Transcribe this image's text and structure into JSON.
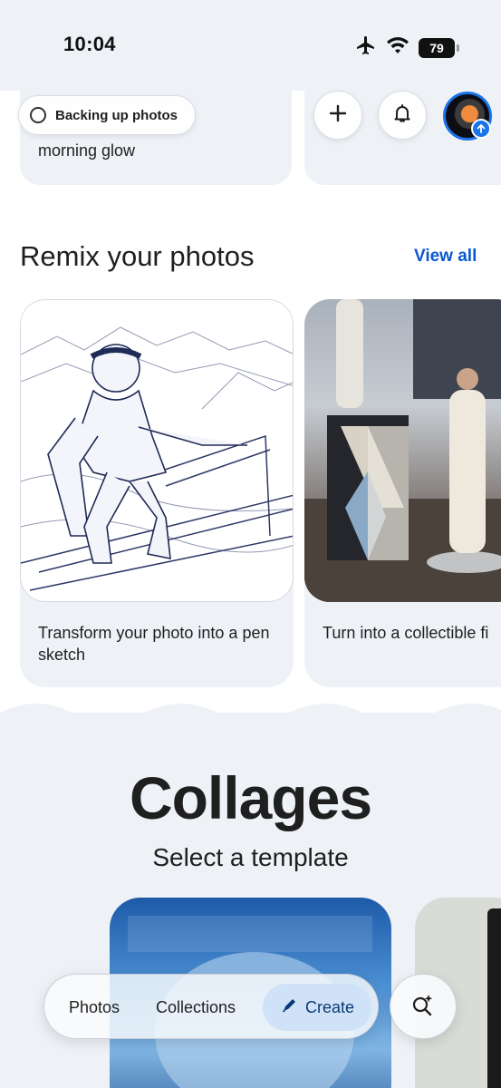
{
  "status_bar": {
    "time": "10:04",
    "battery": "79"
  },
  "previous_cards": {
    "caption_1": "morning glow"
  },
  "top_bar": {
    "backup_chip_label": "Backing up photos"
  },
  "remix": {
    "title": "Remix your photos",
    "view_all": "View all",
    "cards": [
      {
        "caption": "Transform your photo into a pen sketch"
      },
      {
        "caption": "Turn into a collectible fi"
      }
    ]
  },
  "collages": {
    "title": "Collages",
    "subtitle": "Select a template"
  },
  "bottom_nav": {
    "items": [
      {
        "label": "Photos"
      },
      {
        "label": "Collections"
      },
      {
        "label": "Create"
      }
    ]
  },
  "colors": {
    "accent": "#0b57d0",
    "avatar_ring": "#1a73e8",
    "create_pill": "#cfe2f8",
    "surface": "#eef1f6"
  },
  "icons": [
    "airplane-icon",
    "wifi-icon",
    "battery-icon",
    "circle-icon",
    "plus-icon",
    "bell-icon",
    "upload-arrow-icon",
    "pen-icon",
    "search-sparkle-icon"
  ]
}
